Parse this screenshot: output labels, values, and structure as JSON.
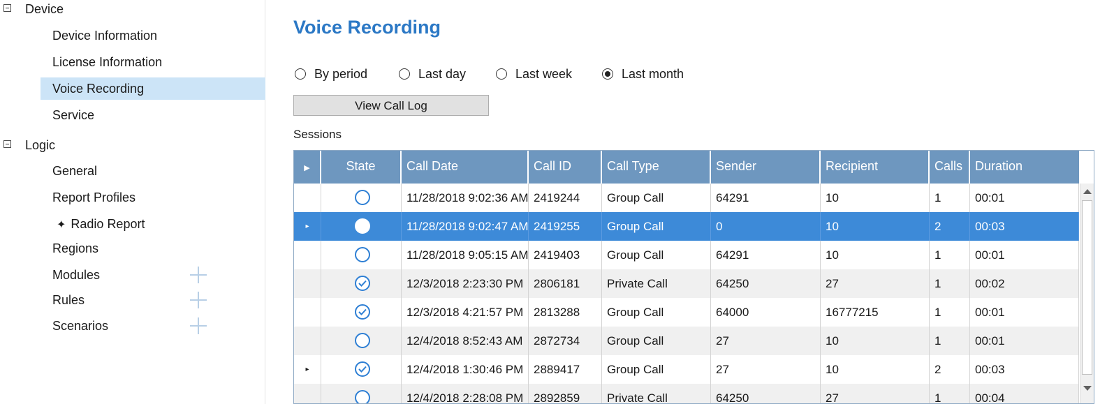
{
  "sidebar": {
    "groups": [
      {
        "label": "Device",
        "items": [
          {
            "label": "Device Information"
          },
          {
            "label": "License Information"
          },
          {
            "label": "Voice Recording",
            "selected": true
          },
          {
            "label": "Service"
          }
        ]
      },
      {
        "label": "Logic",
        "items": [
          {
            "label": "General"
          },
          {
            "label": "Report Profiles"
          },
          {
            "label": "Radio Report",
            "icon": "star-icon"
          },
          {
            "label": "Regions"
          },
          {
            "label": "Modules",
            "action_icon": "plus-icon"
          },
          {
            "label": "Rules",
            "action_icon": "plus-icon"
          },
          {
            "label": "Scenarios",
            "action_icon": "plus-icon"
          }
        ]
      }
    ]
  },
  "main": {
    "title": "Voice Recording",
    "period_options": [
      {
        "label": "By period",
        "checked": false
      },
      {
        "label": "Last day",
        "checked": false
      },
      {
        "label": "Last week",
        "checked": false
      },
      {
        "label": "Last month",
        "checked": true
      }
    ],
    "view_call_log_label": "View Call Log",
    "sessions_label": "Sessions",
    "grid": {
      "columns": [
        "",
        "State",
        "Call Date",
        "Call ID",
        "Call Type",
        "Sender",
        "Recipient",
        "Calls",
        "Duration"
      ],
      "rows": [
        {
          "indicator": "",
          "state": "open",
          "call_date": "11/28/2018 9:02:36 AM",
          "call_id": "2419244",
          "call_type": "Group Call",
          "sender": "64291",
          "recipient": "10",
          "calls": "1",
          "duration": "00:01"
        },
        {
          "indicator": "▸",
          "state": "filled",
          "call_date": "11/28/2018 9:02:47 AM",
          "call_id": "2419255",
          "call_type": "Group Call",
          "sender": "0",
          "recipient": "10",
          "calls": "2",
          "duration": "00:03",
          "selected": true
        },
        {
          "indicator": "",
          "state": "open",
          "call_date": "11/28/2018 9:05:15 AM",
          "call_id": "2419403",
          "call_type": "Group Call",
          "sender": "64291",
          "recipient": "10",
          "calls": "1",
          "duration": "00:01"
        },
        {
          "indicator": "",
          "state": "checked",
          "call_date": "12/3/2018 2:23:30 PM",
          "call_id": "2806181",
          "call_type": "Private Call",
          "sender": "64250",
          "recipient": "27",
          "calls": "1",
          "duration": "00:02"
        },
        {
          "indicator": "",
          "state": "checked",
          "call_date": "12/3/2018 4:21:57 PM",
          "call_id": "2813288",
          "call_type": "Group Call",
          "sender": "64000",
          "recipient": "16777215",
          "calls": "1",
          "duration": "00:01"
        },
        {
          "indicator": "",
          "state": "open",
          "call_date": "12/4/2018 8:52:43 AM",
          "call_id": "2872734",
          "call_type": "Group Call",
          "sender": "27",
          "recipient": "10",
          "calls": "1",
          "duration": "00:01"
        },
        {
          "indicator": "▸",
          "state": "checked",
          "call_date": "12/4/2018 1:30:46 PM",
          "call_id": "2889417",
          "call_type": "Group Call",
          "sender": "27",
          "recipient": "10",
          "calls": "2",
          "duration": "00:03"
        },
        {
          "indicator": "",
          "state": "open",
          "call_date": "12/4/2018 2:28:08 PM",
          "call_id": "2892859",
          "call_type": "Private Call",
          "sender": "64250",
          "recipient": "27",
          "calls": "1",
          "duration": "00:04"
        }
      ]
    }
  },
  "colors": {
    "accent": "#2b78c5",
    "header_bg": "#6e97bf",
    "selected_row": "#3d8ad8",
    "sidebar_selected": "#cce4f7"
  }
}
